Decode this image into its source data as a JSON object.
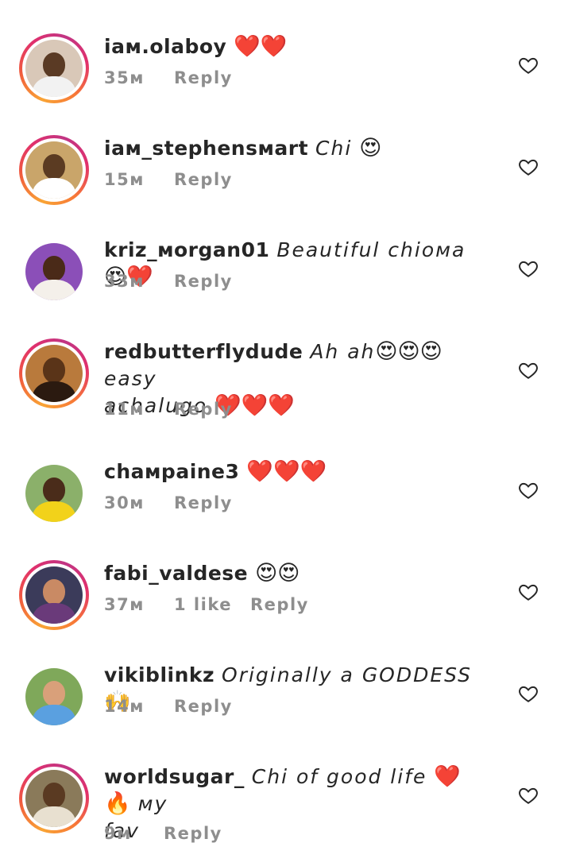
{
  "comments": [
    {
      "username": "iaм.olaboy",
      "text": "",
      "emoji": "❤️❤️",
      "time": "35м",
      "likes": "",
      "reply": "Reply",
      "avatar": {
        "ring": true,
        "bg": "#d9c8b8",
        "skin": "#5a3a24",
        "cloth": "#f2f2f2"
      }
    },
    {
      "username": "iaм_stephensмart",
      "text": "Chi",
      "emoji": "😍",
      "time": "15м",
      "likes": "",
      "reply": "Reply",
      "avatar": {
        "ring": true,
        "bg": "#c9a56a",
        "skin": "#5b3b22",
        "cloth": "#ffffff"
      }
    },
    {
      "username": "kriz_мorgan01",
      "text": "Beautiful chioмa",
      "emoji": "😍❤️",
      "time": "33м",
      "likes": "",
      "reply": "Reply",
      "avatar": {
        "ring": false,
        "bg": "#8b4fb8",
        "skin": "#4a2a18",
        "cloth": "#f4f0ea"
      }
    },
    {
      "username": "redbutterflydude",
      "text": "Ah ah",
      "emoji": "😍😍😍",
      "text2": "easy",
      "text3": "achalugo",
      "emoji2": "❤️❤️❤️",
      "time": "11м",
      "likes": "",
      "reply": "Reply",
      "avatar": {
        "ring": true,
        "bg": "#b97a3c",
        "skin": "#5a3418",
        "cloth": "#2b1a10"
      }
    },
    {
      "username": "chaмpaine3",
      "text": "",
      "emoji": "❤️❤️❤️",
      "time": "30м",
      "likes": "",
      "reply": "Reply",
      "avatar": {
        "ring": false,
        "bg": "#8bb06a",
        "skin": "#4a2c1a",
        "cloth": "#f2d21a"
      }
    },
    {
      "username": "fabi_valdese",
      "text": "",
      "emoji": "😍😍",
      "time": "37м",
      "likes": "1 like",
      "reply": "Reply",
      "avatar": {
        "ring": true,
        "bg": "#3b3b5a",
        "skin": "#c98a64",
        "cloth": "#6a3a7a"
      }
    },
    {
      "username": "vikiblinkz",
      "text": "Originally a GODDESS",
      "emoji": "🙌",
      "time": "14м",
      "likes": "",
      "reply": "Reply",
      "avatar": {
        "ring": false,
        "bg": "#7fa85a",
        "skin": "#d9a07a",
        "cloth": "#5aa0e0"
      }
    },
    {
      "username": "worldsugar_",
      "text": "Chi of good life",
      "emoji": "❤️🔥",
      "text4": "мy",
      "text5": "fav",
      "time": "9м",
      "likes": "",
      "reply": "Reply",
      "avatar": {
        "ring": true,
        "bg": "#8a7a5a",
        "skin": "#5a3a22",
        "cloth": "#e8e0d0"
      }
    }
  ],
  "icons": {
    "like": "heart-outline-icon"
  },
  "colors": {
    "text": "#262626",
    "meta": "#8e8e8e",
    "ring_start": "#f9a435",
    "ring_end": "#c13584"
  }
}
